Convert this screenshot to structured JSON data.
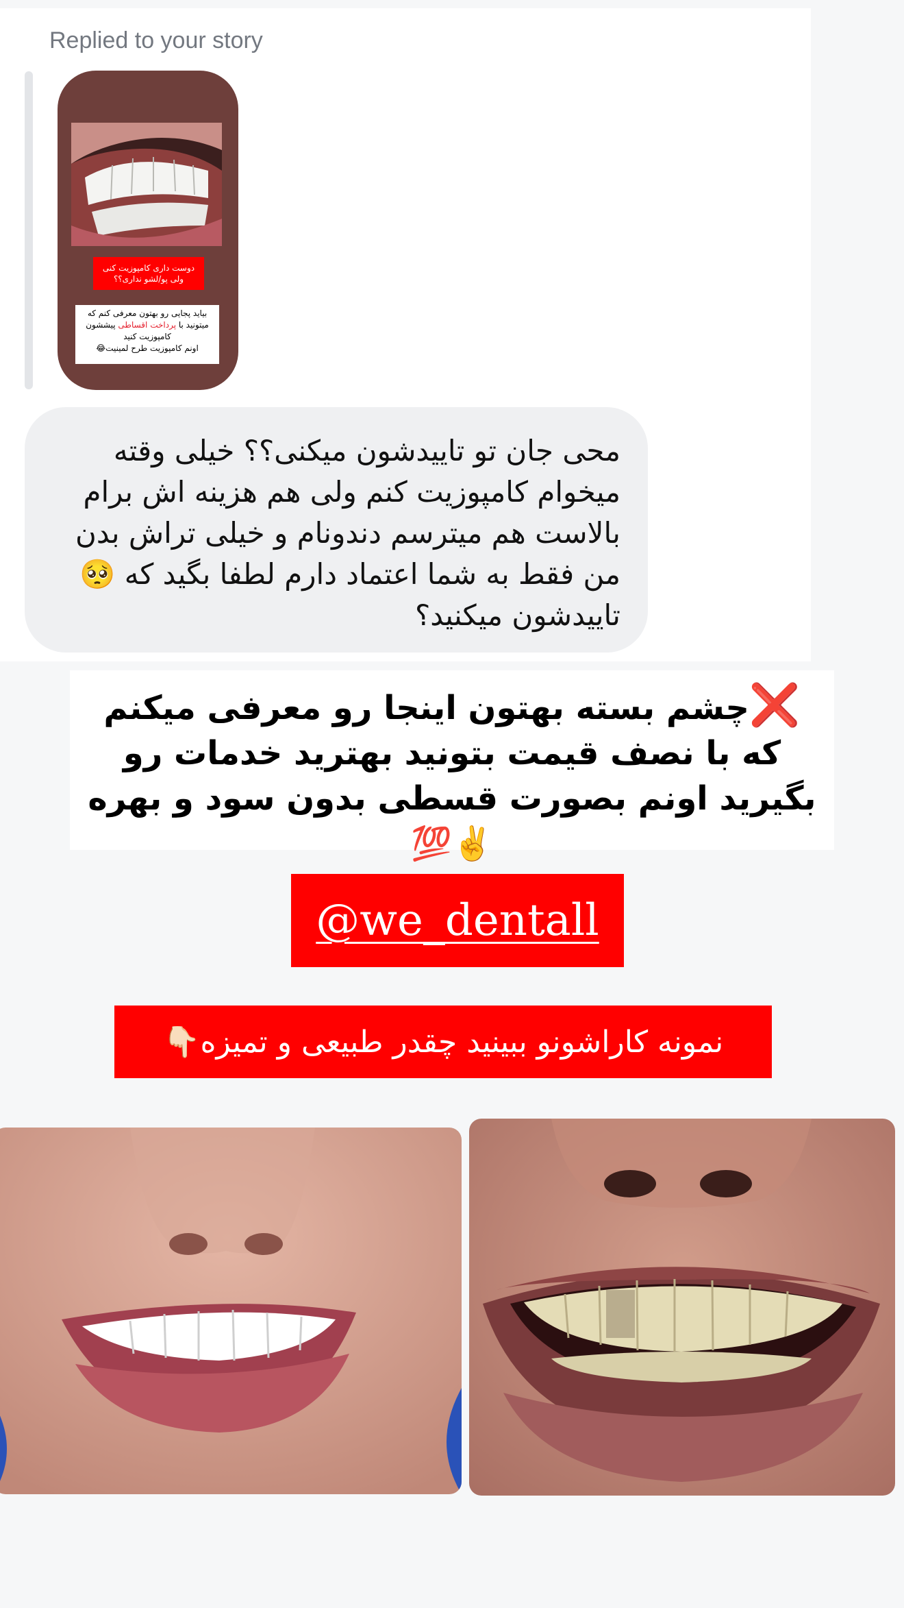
{
  "story_reply": {
    "label": "Replied to your story",
    "story": {
      "red_caption": "دوست داری کامپوزیت کنی ولی پو/لشو نداری؟؟",
      "white_line1": "بیاید پجایی رو بهتون معرفی کنم که",
      "white_line2_pre": "میتونید با ",
      "white_line2_red": "پرداخت اقساطی",
      "white_line2_post": " پیششون",
      "white_line3": "کامپوزیت کنید",
      "white_line4": "اونم کامپوزیت طرح لمینیت😂"
    }
  },
  "message": {
    "text": "محی جان تو تاییدشون میکنی؟؟ خیلی وقته میخوام کامپوزیت کنم ولی هم هزینه اش برام بالاست هم میترسم دندونام و خیلی تراش بدن من فقط به شما اعتماد دارم لطفا بگید که 🥺 تاییدشون میکنید؟"
  },
  "headline": {
    "mark": "❌",
    "text": "چشم بسته بهتون اینجا رو معرفی میکنم که با نصف قیمت بتونید بهترید خدمات رو بگیرید اونم بصورت قسطی بدون سود و بهره ✌️💯"
  },
  "handle": {
    "text": "@we_dentall"
  },
  "samples_caption": {
    "text": "نمونه کاراشونو ببینید چقدر طبیعی و تمیزه👇🏻"
  },
  "colors": {
    "accent_red": "#ff0000",
    "bubble": "#eff0f2",
    "story_bg": "#6e3f3b"
  },
  "images": {
    "story_photo": "teeth-closeup-photo",
    "after": "white-smile-photo",
    "before": "natural-teeth-photo"
  }
}
